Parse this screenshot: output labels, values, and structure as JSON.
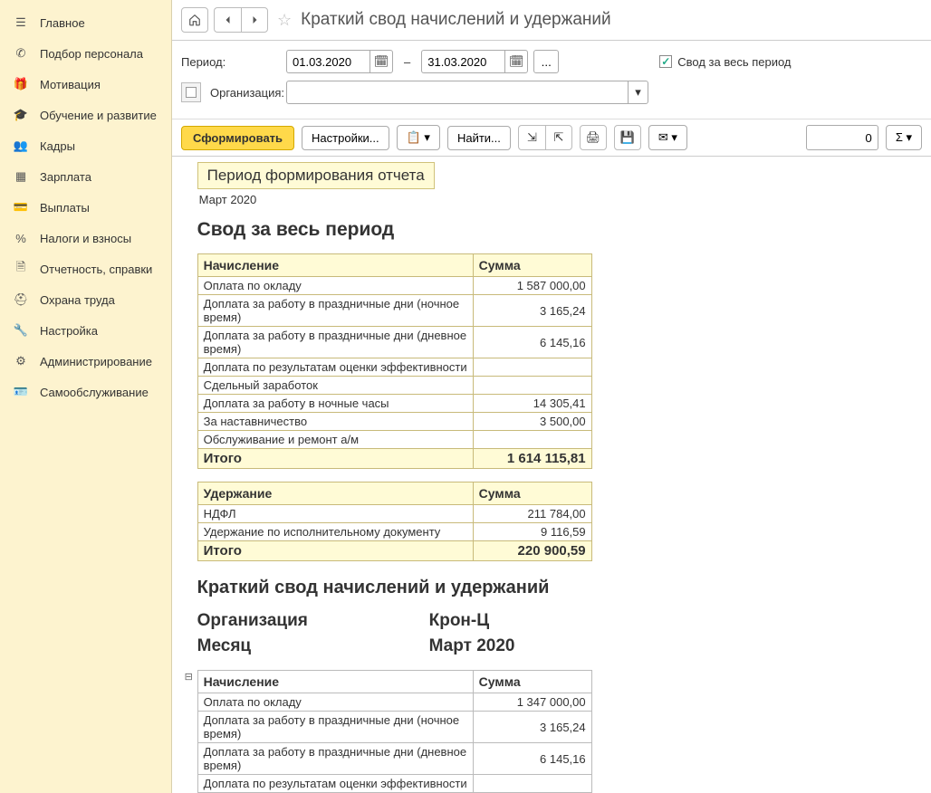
{
  "sidebar": {
    "items": [
      {
        "label": "Главное",
        "icon": "menu-icon"
      },
      {
        "label": "Подбор персонала",
        "icon": "phone-icon"
      },
      {
        "label": "Мотивация",
        "icon": "gift-icon"
      },
      {
        "label": "Обучение и развитие",
        "icon": "graduation-icon"
      },
      {
        "label": "Кадры",
        "icon": "people-icon"
      },
      {
        "label": "Зарплата",
        "icon": "grid-icon"
      },
      {
        "label": "Выплаты",
        "icon": "card-icon"
      },
      {
        "label": "Налоги и взносы",
        "icon": "percent-icon"
      },
      {
        "label": "Отчетность, справки",
        "icon": "report-icon"
      },
      {
        "label": "Охрана труда",
        "icon": "helmet-icon"
      },
      {
        "label": "Настройка",
        "icon": "wrench-icon"
      },
      {
        "label": "Администрирование",
        "icon": "gear-icon"
      },
      {
        "label": "Самообслуживание",
        "icon": "id-icon"
      }
    ]
  },
  "topbar": {
    "title": "Краткий свод начислений и удержаний"
  },
  "filters": {
    "period_label": "Период:",
    "date_from": "01.03.2020",
    "date_to": "31.03.2020",
    "more": "...",
    "checkbox_label": "Свод за весь период",
    "org_label": "Организация:"
  },
  "toolbar": {
    "form": "Сформировать",
    "settings": "Настройки...",
    "find": "Найти...",
    "number": "0"
  },
  "report": {
    "header_box": "Период формирования отчета",
    "header_sub": "Март 2020",
    "summary_title": "Свод за весь период",
    "accrual_header": "Начисление",
    "sum_header": "Сумма",
    "accruals": [
      {
        "name": "Оплата по окладу",
        "sum": "1 587 000,00"
      },
      {
        "name": "Доплата за работу в праздничные дни (ночное время)",
        "sum": "3 165,24"
      },
      {
        "name": "Доплата за работу в праздничные дни (дневное время)",
        "sum": "6 145,16"
      },
      {
        "name": "Доплата по результатам оценки эффективности",
        "sum": ""
      },
      {
        "name": "Сдельный заработок",
        "sum": ""
      },
      {
        "name": "Доплата за работу в ночные часы",
        "sum": "14 305,41"
      },
      {
        "name": "За наставничество",
        "sum": "3 500,00"
      },
      {
        "name": "Обслуживание и ремонт а/м",
        "sum": ""
      }
    ],
    "accruals_total": {
      "name": "Итого",
      "sum": "1 614 115,81"
    },
    "deduction_header": "Удержание",
    "deductions": [
      {
        "name": "НДФЛ",
        "sum": "211 784,00"
      },
      {
        "name": "Удержание по исполнительному документу",
        "sum": "9 116,59"
      }
    ],
    "deductions_total": {
      "name": "Итого",
      "sum": "220 900,59"
    },
    "detail_title": "Краткий свод начислений и удержаний",
    "org_key": "Организация",
    "org_val": "Крон-Ц",
    "month_key": "Месяц",
    "month_val": "Март 2020",
    "detail_accruals": [
      {
        "name": "Оплата по окладу",
        "sum": "1 347 000,00"
      },
      {
        "name": "Доплата за работу в праздничные дни (ночное время)",
        "sum": "3 165,24"
      },
      {
        "name": "Доплата за работу в праздничные дни (дневное время)",
        "sum": "6 145,16"
      },
      {
        "name": "Доплата по результатам оценки эффективности",
        "sum": ""
      }
    ]
  }
}
